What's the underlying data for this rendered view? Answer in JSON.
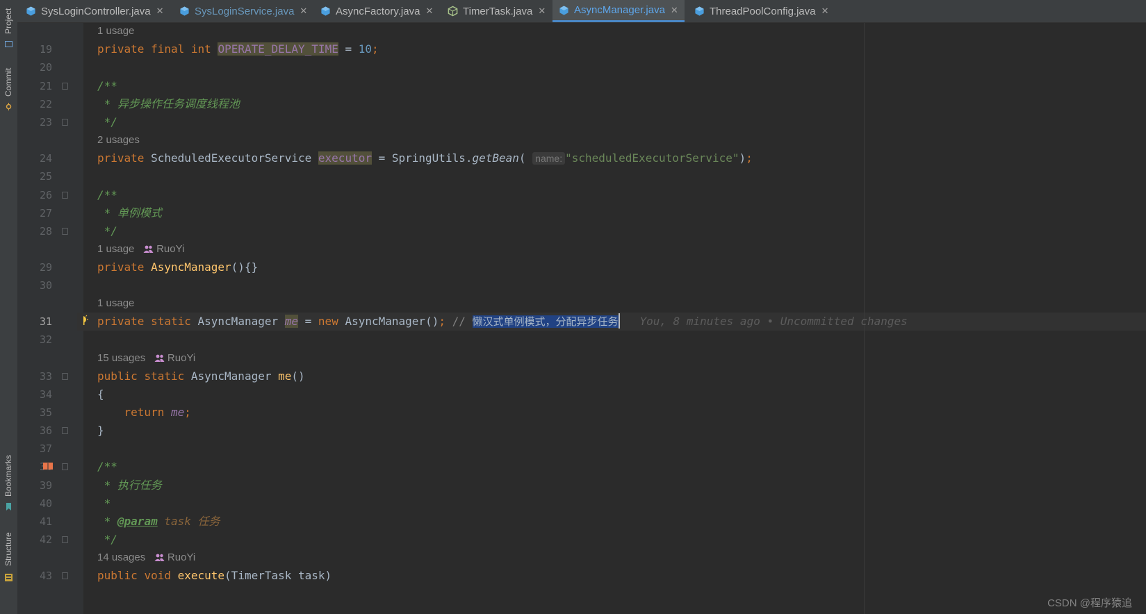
{
  "left_toolbar": {
    "project": "Project",
    "commit": "Commit",
    "bookmarks": "Bookmarks",
    "structure": "Structure"
  },
  "tabs": [
    {
      "label": "SysLoginController.java",
      "icon": "java-class-icon",
      "active": false,
      "modified": false
    },
    {
      "label": "SysLoginService.java",
      "icon": "java-class-icon",
      "active": false,
      "modified": true
    },
    {
      "label": "AsyncFactory.java",
      "icon": "java-class-icon",
      "active": false,
      "modified": false
    },
    {
      "label": "TimerTask.java",
      "icon": "java-abstract-class-icon",
      "active": false,
      "modified": false
    },
    {
      "label": "AsyncManager.java",
      "icon": "java-class-icon",
      "active": true,
      "modified": true
    },
    {
      "label": "ThreadPoolConfig.java",
      "icon": "java-class-icon",
      "active": false,
      "modified": false
    }
  ],
  "colors": {
    "accent": "#4a88c7",
    "keyword": "#cc7832",
    "comment": "#629755",
    "string": "#6a8759",
    "field": "#9876aa",
    "method": "#ffc66d",
    "selection": "#214283"
  },
  "editor": {
    "lines": {
      "n19": "19",
      "n20": "20",
      "n21": "21",
      "n22": "22",
      "n23": "23",
      "n24": "24",
      "n25": "25",
      "n26": "26",
      "n27": "27",
      "n28": "28",
      "n29": "29",
      "n30": "30",
      "n31": "31",
      "n32": "32",
      "n33": "33",
      "n34": "34",
      "n35": "35",
      "n36": "36",
      "n37": "37",
      "n38": "38",
      "n39": "39",
      "n40": "40",
      "n41": "41",
      "n42": "42",
      "n43": "43"
    },
    "hints": {
      "h19": "1 usage",
      "h24": "2 usages",
      "h29": "1 usage",
      "h31": "1 usage",
      "h33": "15 usages",
      "h43": "14 usages",
      "author": "RuoYi"
    },
    "code": {
      "private": "private",
      "final": "final",
      "int": "int",
      "static": "static",
      "public": "public",
      "new": "new",
      "return": "return",
      "void": "void",
      "delay_field": "OPERATE_DELAY_TIME",
      "delay_value": "10",
      "executor_type": "ScheduledExecutorService",
      "executor_field": "executor",
      "spring_utils": "SpringUtils.",
      "get_bean": "getBean",
      "param_hint": "name:",
      "bean_name": "\"scheduledExecutorService\"",
      "doc_open": "/**",
      "doc_close": "*/",
      "doc_star": "*",
      "doc_async_pool": "* 异步操作任务调度线程池",
      "doc_singleton": "* 单例模式",
      "doc_execute": "* 执行任务",
      "doc_param_tag": "@param",
      "doc_param_name": "task",
      "doc_param_desc": "任务",
      "class_name": "AsyncManager",
      "ctor_body": "(){}",
      "me_field": "me",
      "ctor_call": "AsyncManager()",
      "line_comment_prefix": "//",
      "line_comment_text": "懒汉式单例模式，分配异步任务",
      "blame": "You, 8 minutes ago • Uncommitted changes",
      "me_method": "me",
      "open_brace": "{",
      "close_brace": "}",
      "me_ref": "me",
      "execute_method": "execute",
      "execute_params": "(TimerTask task)"
    }
  },
  "watermark": "CSDN @程序猿追"
}
